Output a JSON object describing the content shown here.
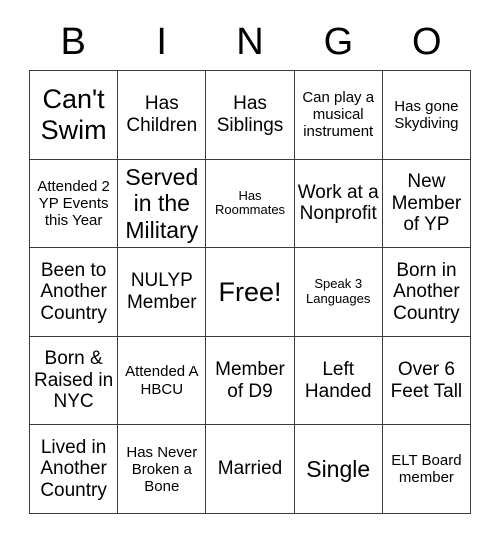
{
  "card": {
    "title_letters": [
      "B",
      "I",
      "N",
      "G",
      "O"
    ],
    "columns": 5,
    "rows": 5,
    "free_space_label": "Free!",
    "free_space_position": "center",
    "colors": {
      "background": "#ffffff",
      "text": "#000000",
      "grid_line": "#3c3c3c"
    },
    "cells": [
      [
        {
          "text": "Can't Swim",
          "size": "xl"
        },
        {
          "text": "Has Children",
          "size": "md"
        },
        {
          "text": "Has Siblings",
          "size": "md"
        },
        {
          "text": "Can play a musical instrument",
          "size": "sm"
        },
        {
          "text": "Has gone Skydiving",
          "size": "sm"
        }
      ],
      [
        {
          "text": "Attended 2 YP Events this Year",
          "size": "sm"
        },
        {
          "text": "Served in the Military",
          "size": "lg"
        },
        {
          "text": "Has Roommates",
          "size": "xs"
        },
        {
          "text": "Work at a Nonprofit",
          "size": "md"
        },
        {
          "text": "New Member of YP",
          "size": "md"
        }
      ],
      [
        {
          "text": "Been to Another Country",
          "size": "md"
        },
        {
          "text": "NULYP Member",
          "size": "md"
        },
        {
          "text": "Free!",
          "size": "xl"
        },
        {
          "text": "Speak 3 Languages",
          "size": "xs"
        },
        {
          "text": "Born in Another Country",
          "size": "md"
        }
      ],
      [
        {
          "text": "Born & Raised in NYC",
          "size": "md"
        },
        {
          "text": "Attended A HBCU",
          "size": "sm"
        },
        {
          "text": "Member of D9",
          "size": "md"
        },
        {
          "text": "Left Handed",
          "size": "md"
        },
        {
          "text": "Over 6 Feet Tall",
          "size": "md"
        }
      ],
      [
        {
          "text": "Lived in Another Country",
          "size": "md"
        },
        {
          "text": "Has Never Broken a Bone",
          "size": "sm"
        },
        {
          "text": "Married",
          "size": "md"
        },
        {
          "text": "Single",
          "size": "lg"
        },
        {
          "text": "ELT Board member",
          "size": "sm"
        }
      ]
    ]
  }
}
